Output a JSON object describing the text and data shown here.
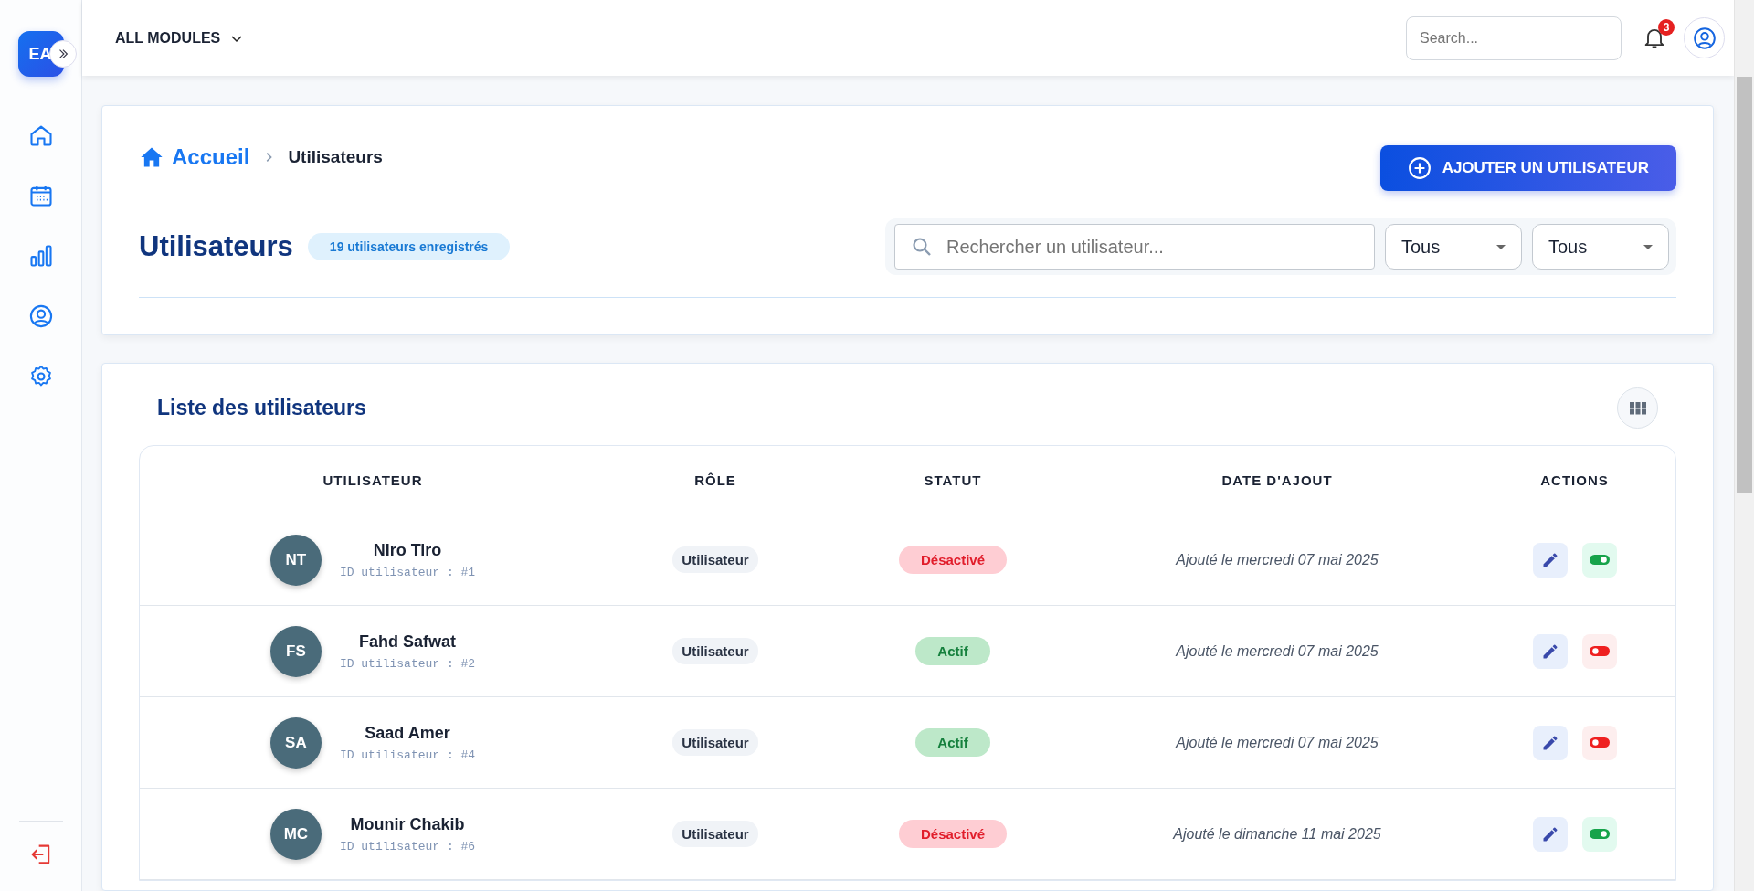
{
  "sidebar": {
    "logo": "EA",
    "items": [
      {
        "kind": "home"
      },
      {
        "kind": "calendar"
      },
      {
        "kind": "chart"
      },
      {
        "kind": "user"
      },
      {
        "kind": "settings"
      }
    ]
  },
  "topbar": {
    "modules": "ALL MODULES",
    "search_placeholder": "Search...",
    "notifications": "3"
  },
  "breadcrumb": {
    "home": "Accueil",
    "current": "Utilisateurs"
  },
  "add_button": "AJOUTER UN UTILISATEUR",
  "page_title": "Utilisateurs",
  "count_badge": "19 utilisateurs enregistrés",
  "filters": {
    "search_placeholder": "Rechercher un utilisateur...",
    "selects": [
      "Tous",
      "Tous"
    ]
  },
  "list_title": "Liste des utilisateurs",
  "table": {
    "columns": [
      "UTILISATEUR",
      "RÔLE",
      "STATUT",
      "DATE D'AJOUT",
      "ACTIONS"
    ],
    "rows": [
      {
        "initials": "NT",
        "name": "Niro Tiro",
        "id": "ID utilisateur : #1",
        "role": "Utilisateur",
        "status": {
          "label": "Désactivé",
          "kind": "inactive"
        },
        "date": "Ajouté le mercredi 07 mai 2025"
      },
      {
        "initials": "FS",
        "name": "Fahd Safwat",
        "id": "ID utilisateur : #2",
        "role": "Utilisateur",
        "status": {
          "label": "Actif",
          "kind": "active"
        },
        "date": "Ajouté le mercredi 07 mai 2025"
      },
      {
        "initials": "SA",
        "name": "Saad Amer",
        "id": "ID utilisateur : #4",
        "role": "Utilisateur",
        "status": {
          "label": "Actif",
          "kind": "active"
        },
        "date": "Ajouté le mercredi 07 mai 2025"
      },
      {
        "initials": "MC",
        "name": "Mounir Chakib",
        "id": "ID utilisateur : #6",
        "role": "Utilisateur",
        "status": {
          "label": "Désactivé",
          "kind": "inactive"
        },
        "date": "Ajouté le dimanche 11 mai 2025"
      }
    ]
  }
}
